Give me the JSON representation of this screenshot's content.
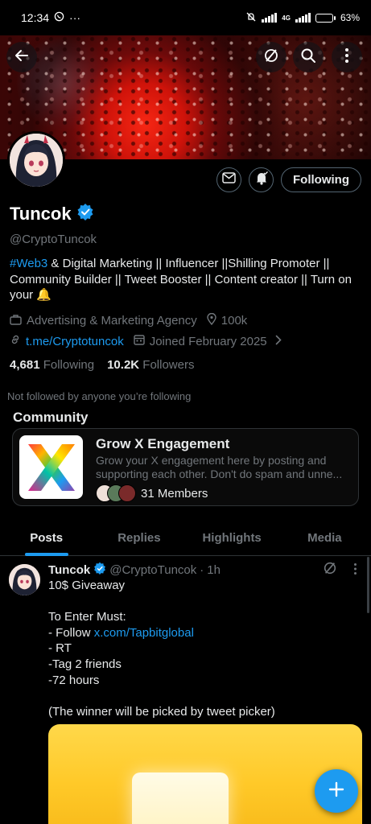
{
  "status_bar": {
    "time": "12:34",
    "more": "···",
    "net": "4G",
    "battery_pct": "63%",
    "battery_level": 0.63
  },
  "profile": {
    "name": "Tuncok",
    "handle": "@CryptoTuncok",
    "bio_hashtag": "#Web3",
    "bio_text": " & Digital Marketing || Influencer ||Shilling Promoter || Community Builder ||  Tweet Booster || Content creator || Turn on your 🔔",
    "category": "Advertising & Marketing Agency",
    "location": "100k",
    "website": "t.me/Cryptotuncok",
    "joined": "Joined February 2025",
    "following_count": "4,681",
    "following_label": "Following",
    "followers_count": "10.2K",
    "followers_label": "Followers",
    "not_followed_note": "Not followed by anyone you’re following",
    "follow_button": "Following"
  },
  "community": {
    "section_title": "Community",
    "name": "Grow X Engagement",
    "desc_line1": "Grow your X engagement here by posting and",
    "desc_line2": "supporting each other. Don't do spam and unne...",
    "members": "31 Members"
  },
  "tabs": [
    {
      "label": "Posts",
      "active": true
    },
    {
      "label": "Replies",
      "active": false
    },
    {
      "label": "Highlights",
      "active": false
    },
    {
      "label": "Media",
      "active": false
    }
  ],
  "post": {
    "author": "Tuncok",
    "handle": "@CryptoTuncok",
    "sep": "·",
    "time": "1h",
    "line1": "10$ Giveaway",
    "line2": "To Enter Must:",
    "line3_prefix": "- Follow ",
    "line3_link": "x.com/Tapbitglobal",
    "line4": "- RT",
    "line5": "-Tag 2 friends",
    "line6": "-72 hours",
    "line7": "(The winner will be picked by tweet picker)"
  },
  "colors": {
    "accent": "#1d9bf0",
    "muted": "#71767b",
    "text": "#e7e9ea",
    "border": "#2f3336"
  },
  "icons": [
    "back-arrow-icon",
    "grok-icon",
    "search-icon",
    "more-vertical-icon",
    "mail-icon",
    "bell-icon",
    "verified-badge-icon",
    "briefcase-icon",
    "location-icon",
    "link-icon",
    "calendar-icon",
    "chevron-right-icon",
    "plus-icon"
  ]
}
